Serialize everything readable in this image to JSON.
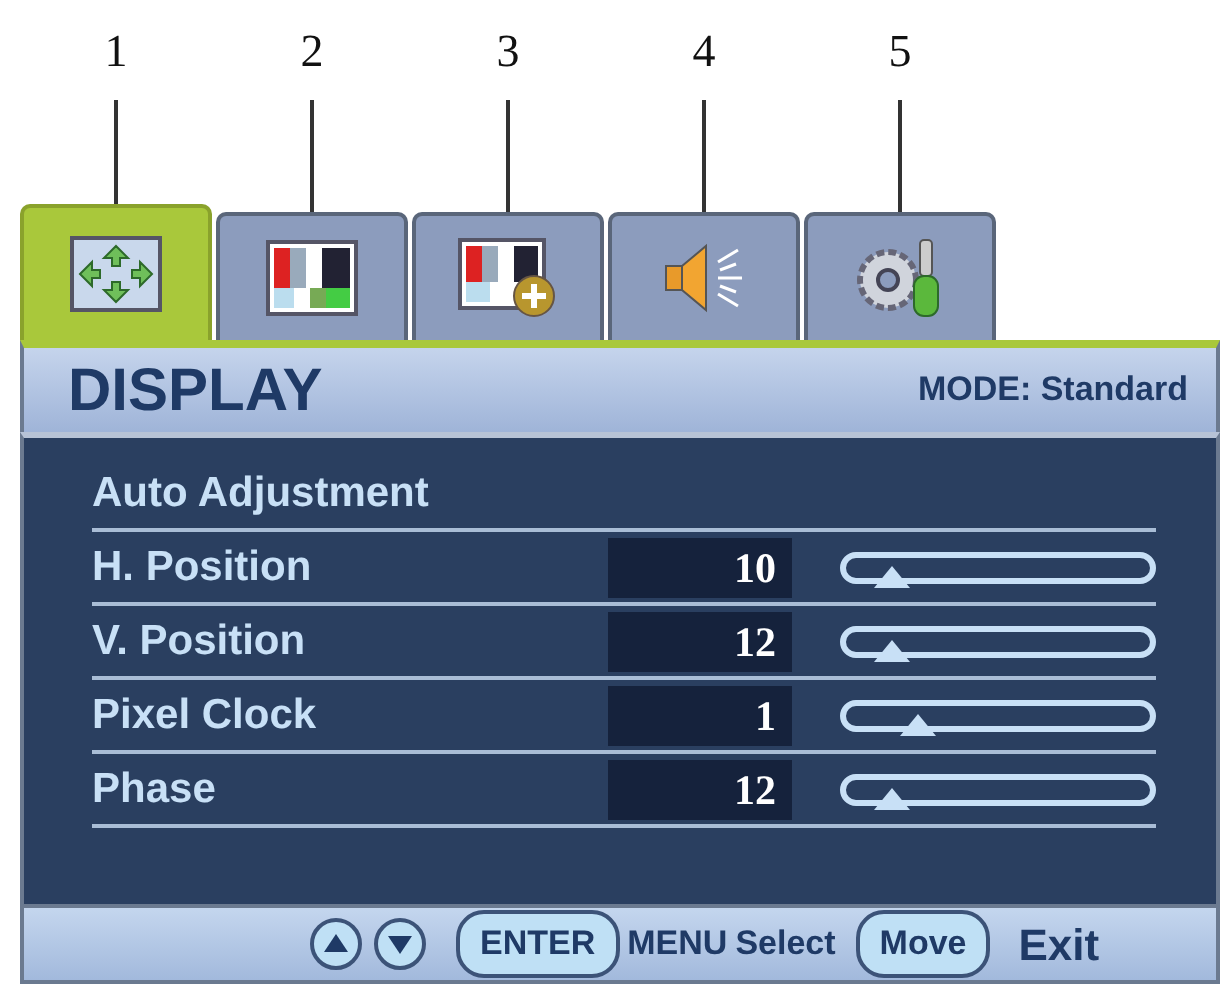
{
  "tabs": [
    {
      "callout": "1",
      "kind": "display",
      "selected": true
    },
    {
      "callout": "2",
      "kind": "picture",
      "selected": false
    },
    {
      "callout": "3",
      "kind": "picture-advanced",
      "selected": false
    },
    {
      "callout": "4",
      "kind": "audio",
      "selected": false
    },
    {
      "callout": "5",
      "kind": "system",
      "selected": false
    }
  ],
  "header": {
    "title": "DISPLAY",
    "mode": "MODE: Standard"
  },
  "items": [
    {
      "label": "Auto Adjustment",
      "kind": "action"
    },
    {
      "label": "H. Position",
      "kind": "slider",
      "value": "10",
      "level": 0.15
    },
    {
      "label": "V. Position",
      "kind": "slider",
      "value": "12",
      "level": 0.15
    },
    {
      "label": "Pixel Clock",
      "kind": "slider",
      "value": "1",
      "level": 0.24
    },
    {
      "label": "Phase",
      "kind": "slider",
      "value": "12",
      "level": 0.15
    }
  ],
  "footer": [
    {
      "kind": "up-key"
    },
    {
      "kind": "down-key"
    },
    {
      "kind": "pill",
      "text": "ENTER"
    },
    {
      "kind": "label",
      "text": "MENU"
    },
    {
      "kind": "label",
      "text": "Select"
    },
    {
      "kind": "pill",
      "text": "Move"
    },
    {
      "kind": "exit",
      "text": "Exit"
    }
  ]
}
